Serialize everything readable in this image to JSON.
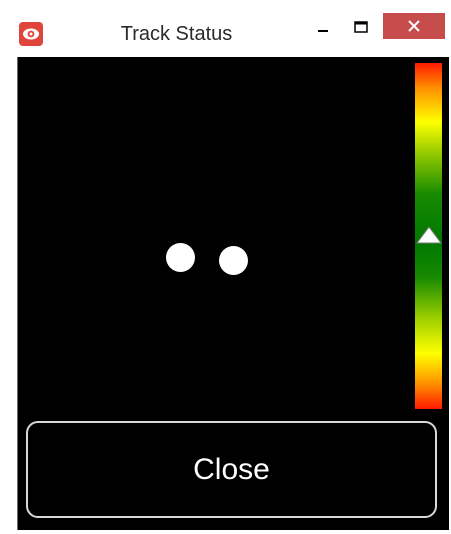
{
  "window": {
    "title": "Track Status",
    "icons": {
      "app": "eye-icon",
      "minimize": "minimize-icon",
      "maximize": "maximize-icon",
      "close": "close-icon"
    },
    "colors": {
      "close_button_bg": "#c74c4c",
      "client_bg": "#000000"
    }
  },
  "tracker": {
    "targets": [
      {
        "name": "left-eye",
        "color": "#ffffff"
      },
      {
        "name": "right-eye",
        "color": "#ffffff"
      }
    ],
    "distance_meter": {
      "level": 0.5,
      "scale_colors": [
        "#ff1a00",
        "#ffff00",
        "#007800",
        "#ffff00",
        "#ff1a00"
      ],
      "marker_color": "#ffffff"
    }
  },
  "actions": {
    "close_label": "Close"
  }
}
